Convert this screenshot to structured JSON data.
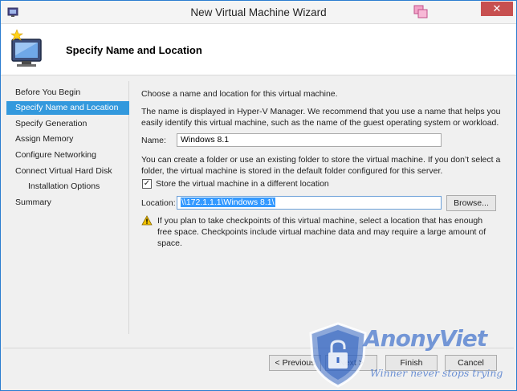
{
  "window": {
    "title": "New Virtual Machine Wizard",
    "close_glyph": "✕"
  },
  "header": {
    "title": "Specify Name and Location",
    "icon": "virtual-machine-wizard-icon"
  },
  "nav": {
    "items": [
      {
        "label": "Before You Begin",
        "active": false,
        "indent": false
      },
      {
        "label": "Specify Name and Location",
        "active": true,
        "indent": false
      },
      {
        "label": "Specify Generation",
        "active": false,
        "indent": false
      },
      {
        "label": "Assign Memory",
        "active": false,
        "indent": false
      },
      {
        "label": "Configure Networking",
        "active": false,
        "indent": false
      },
      {
        "label": "Connect Virtual Hard Disk",
        "active": false,
        "indent": false
      },
      {
        "label": "Installation Options",
        "active": false,
        "indent": true
      },
      {
        "label": "Summary",
        "active": false,
        "indent": false
      }
    ]
  },
  "main": {
    "intro": "Choose a name and location for this virtual machine.",
    "name_help": "The name is displayed in Hyper-V Manager. We recommend that you use a name that helps you easily identify this virtual machine, such as the name of the guest operating system or workload.",
    "name_label": "Name:",
    "name_value": "Windows 8.1",
    "folder_help": "You can create a folder or use an existing folder to store the virtual machine. If you don’t select a folder, the virtual machine is stored in the default folder configured for this server.",
    "store_checkbox_label": "Store the virtual machine in a different location",
    "store_checked": true,
    "check_glyph": "✓",
    "location_label": "Location:",
    "location_value": "\\\\172.1.1.1\\Windows 8.1\\",
    "browse_label": "Browse...",
    "warning_text": "If you plan to take checkpoints of this virtual machine, select a location that has enough free space. Checkpoints include virtual machine data and may require a large amount of space."
  },
  "footer": {
    "previous_label": "< Previous",
    "next_label": "Next >",
    "finish_label": "Finish",
    "cancel_label": "Cancel"
  },
  "watermark": {
    "brand": "AnonyViet",
    "tagline": "Winner never stops trying"
  },
  "colors": {
    "accent": "#3399dd",
    "selection": "#3399ff",
    "close_button": "#c75050",
    "warning": "#f2c200"
  }
}
